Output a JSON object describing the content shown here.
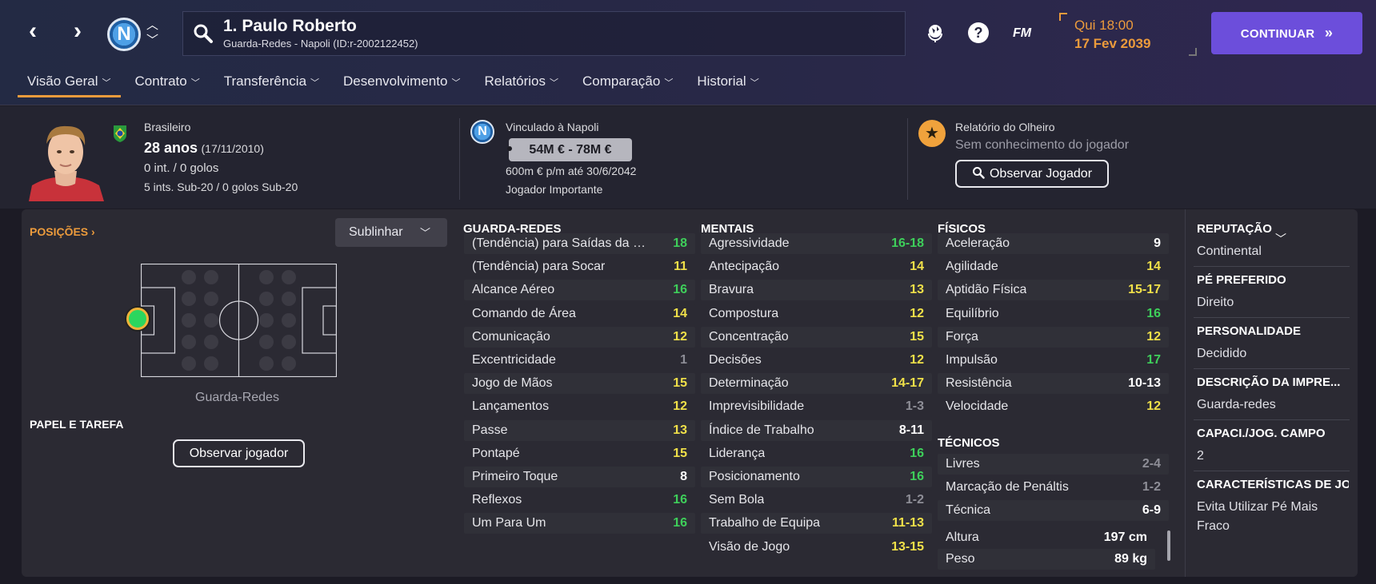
{
  "header": {
    "player_name": "1. Paulo Roberto",
    "player_sub": "Guarda-Redes - Napoli (ID:r-2002122452)",
    "club_badge_letter": "N",
    "date_day": "Qui 18:00",
    "date_full": "17 Fev 2039",
    "continue_label": "CONTINUAR",
    "fm_label": "FM",
    "icons": [
      "back-arrow-icon",
      "forward-arrow-icon",
      "search-icon",
      "globe-icon",
      "help-icon",
      "fm-logo-icon",
      "double-chevron-right-icon"
    ]
  },
  "tabs": [
    {
      "label": "Visão Geral",
      "active": true
    },
    {
      "label": "Contrato"
    },
    {
      "label": "Transferência"
    },
    {
      "label": "Desenvolvimento"
    },
    {
      "label": "Relatórios"
    },
    {
      "label": "Comparação"
    },
    {
      "label": "Historial"
    }
  ],
  "info": {
    "nationality": "Brasileiro",
    "age": "28 anos",
    "birth": "(17/11/2010)",
    "caps": "0 int. / 0 golos",
    "u20_caps": "5 ints. Sub-20 / 0 golos Sub-20",
    "contract_with": "Vinculado à Napoli",
    "value_range": "54M € - 78M €",
    "wage": "600m € p/m até 30/6/2042",
    "squad_status": "Jogador Importante",
    "scout_title": "Relatório do Olheiro",
    "scout_sub": "Sem conhecimento do jogador",
    "scout_button": "Observar Jogador"
  },
  "positions": {
    "title": "POSIÇÕES",
    "dropdown": "Sublinhar",
    "position_label": "Guarda-Redes",
    "role_title": "PAPEL E TAREFA",
    "observe_button": "Observar jogador"
  },
  "attributes": {
    "goalkeeping": {
      "title": "GUARDA-REDES",
      "rows": [
        {
          "name": "(Tendência) para Saídas da Área",
          "value": "18",
          "color": "green"
        },
        {
          "name": "(Tendência) para Socar",
          "value": "11",
          "color": "yellow"
        },
        {
          "name": "Alcance Aéreo",
          "value": "16",
          "color": "green"
        },
        {
          "name": "Comando de Área",
          "value": "14",
          "color": "yellow"
        },
        {
          "name": "Comunicação",
          "value": "12",
          "color": "yellow"
        },
        {
          "name": "Excentricidade",
          "value": "1",
          "color": "grey"
        },
        {
          "name": "Jogo de Mãos",
          "value": "15",
          "color": "yellow"
        },
        {
          "name": "Lançamentos",
          "value": "12",
          "color": "yellow"
        },
        {
          "name": "Passe",
          "value": "13",
          "color": "yellow"
        },
        {
          "name": "Pontapé",
          "value": "15",
          "color": "yellow"
        },
        {
          "name": "Primeiro Toque",
          "value": "8",
          "color": "white"
        },
        {
          "name": "Reflexos",
          "value": "16",
          "color": "green"
        },
        {
          "name": "Um Para Um",
          "value": "16",
          "color": "green"
        }
      ]
    },
    "mental": {
      "title": "MENTAIS",
      "rows": [
        {
          "name": "Agressividade",
          "value": "16-18",
          "color": "green"
        },
        {
          "name": "Antecipação",
          "value": "14",
          "color": "yellow"
        },
        {
          "name": "Bravura",
          "value": "13",
          "color": "yellow"
        },
        {
          "name": "Compostura",
          "value": "12",
          "color": "yellow"
        },
        {
          "name": "Concentração",
          "value": "15",
          "color": "yellow"
        },
        {
          "name": "Decisões",
          "value": "12",
          "color": "yellow"
        },
        {
          "name": "Determinação",
          "value": "14-17",
          "color": "yellow"
        },
        {
          "name": "Imprevisibilidade",
          "value": "1-3",
          "color": "grey"
        },
        {
          "name": "Índice de Trabalho",
          "value": "8-11",
          "color": "white"
        },
        {
          "name": "Liderança",
          "value": "16",
          "color": "green"
        },
        {
          "name": "Posicionamento",
          "value": "16",
          "color": "green"
        },
        {
          "name": "Sem Bola",
          "value": "1-2",
          "color": "grey"
        },
        {
          "name": "Trabalho de Equipa",
          "value": "11-13",
          "color": "yellow"
        },
        {
          "name": "Visão de Jogo",
          "value": "13-15",
          "color": "yellow"
        }
      ]
    },
    "physical": {
      "title": "FÍSICOS",
      "rows": [
        {
          "name": "Aceleração",
          "value": "9",
          "color": "white"
        },
        {
          "name": "Agilidade",
          "value": "14",
          "color": "yellow"
        },
        {
          "name": "Aptidão Física",
          "value": "15-17",
          "color": "yellow"
        },
        {
          "name": "Equilíbrio",
          "value": "16",
          "color": "green"
        },
        {
          "name": "Força",
          "value": "12",
          "color": "yellow"
        },
        {
          "name": "Impulsão",
          "value": "17",
          "color": "green"
        },
        {
          "name": "Resistência",
          "value": "10-13",
          "color": "white"
        },
        {
          "name": "Velocidade",
          "value": "12",
          "color": "yellow"
        }
      ]
    },
    "technical": {
      "title": "TÉCNICOS",
      "rows": [
        {
          "name": "Livres",
          "value": "2-4",
          "color": "grey"
        },
        {
          "name": "Marcação de Penáltis",
          "value": "1-2",
          "color": "grey"
        },
        {
          "name": "Técnica",
          "value": "6-9",
          "color": "white"
        }
      ]
    },
    "body": {
      "rows": [
        {
          "name": "Altura",
          "value": "197 cm"
        },
        {
          "name": "Peso",
          "value": "89 kg"
        }
      ]
    }
  },
  "side": [
    {
      "title": "REPUTAÇÃO",
      "value": "Continental"
    },
    {
      "title": "PÉ PREFERIDO",
      "value": "Direito"
    },
    {
      "title": "PERSONALIDADE",
      "value": "Decidido"
    },
    {
      "title": "DESCRIÇÃO DA IMPRE...",
      "value": "Guarda-redes"
    },
    {
      "title": "CAPACI./JOG. CAMPO",
      "value": "2"
    },
    {
      "title": "CARACTERÍSTICAS DE JO",
      "value": "Evita Utilizar Pé Mais Fraco"
    }
  ],
  "colors": {
    "accent": "#ec9b3c",
    "button": "#6c4edb",
    "green": "#3ecf5a",
    "yellow": "#f0e049",
    "grey": "#8e8e97"
  }
}
